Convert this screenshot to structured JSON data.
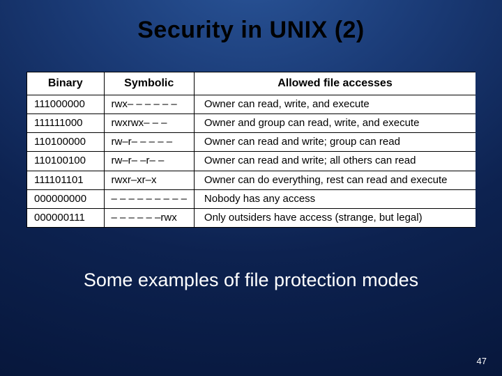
{
  "title": "Security in UNIX (2)",
  "table": {
    "headers": {
      "binary": "Binary",
      "symbolic": "Symbolic",
      "access": "Allowed file accesses"
    },
    "rows": [
      {
        "binary": "111000000",
        "symbolic": "rwx– – – – – –",
        "access": "Owner can read, write, and execute"
      },
      {
        "binary": "111111000",
        "symbolic": "rwxrwx– – –",
        "access": "Owner and group can read, write, and execute"
      },
      {
        "binary": "110100000",
        "symbolic": "rw–r– – – – –",
        "access": "Owner can read and write; group can read"
      },
      {
        "binary": "110100100",
        "symbolic": "rw–r– –r– –",
        "access": "Owner can read and write; all others can read"
      },
      {
        "binary": "111101101",
        "symbolic": "rwxr–xr–x",
        "access": "Owner can do everything, rest can read and execute"
      },
      {
        "binary": "000000000",
        "symbolic": "– – – – – – – – –",
        "access": "Nobody has any access"
      },
      {
        "binary": "000000111",
        "symbolic": "– – – – – –rwx",
        "access": "Only outsiders have access (strange, but legal)"
      }
    ]
  },
  "caption": "Some examples of file protection modes",
  "page_number": "47"
}
